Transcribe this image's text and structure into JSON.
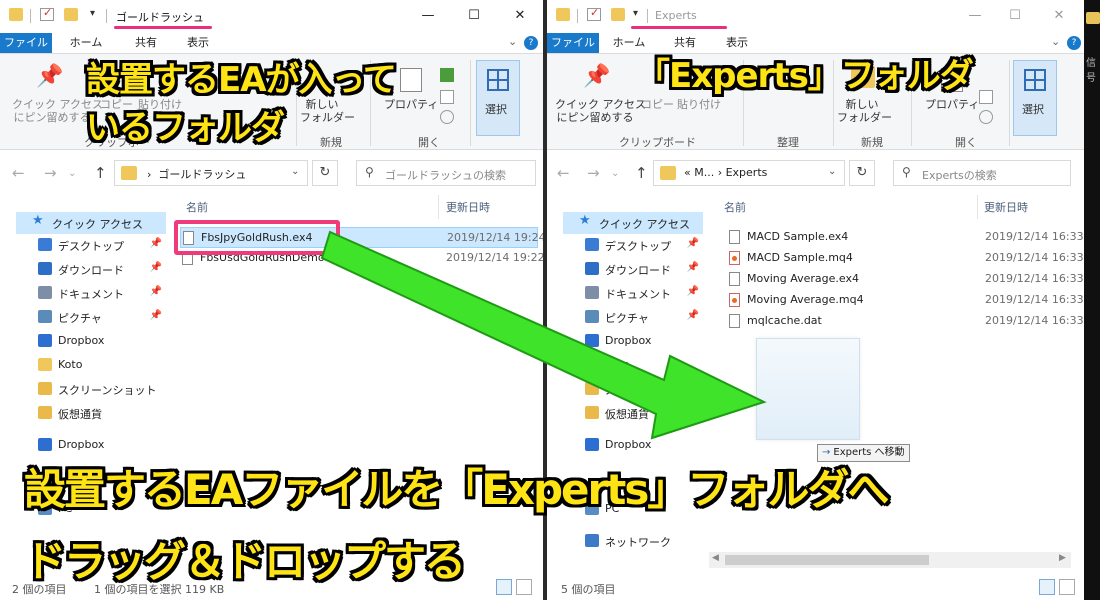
{
  "left_window": {
    "title": "ゴールドラッシュ",
    "tabs": {
      "file": "ファイル",
      "home": "ホーム",
      "share": "共有",
      "view": "表示"
    },
    "ribbon": {
      "quick_access": "クイック アクセス\nにピン留めする",
      "copy": "コピー",
      "paste": "貼り付け",
      "new_folder": "新しい\nフォルダー",
      "properties": "プロパティ",
      "select": "選択",
      "group_clipboard": "クリップボー",
      "group_new": "新規",
      "group_open": "開く"
    },
    "address_path": "ゴールドラッシュ",
    "search_placeholder": "ゴールドラッシュの検索",
    "col_name": "名前",
    "col_date": "更新日時",
    "nav": [
      {
        "label": "クイック アクセス"
      },
      {
        "label": "デスクトップ"
      },
      {
        "label": "ダウンロード"
      },
      {
        "label": "ドキュメント"
      },
      {
        "label": "ピクチャ"
      },
      {
        "label": "Dropbox"
      },
      {
        "label": "Koto"
      },
      {
        "label": "スクリーンショット"
      },
      {
        "label": "仮想通貨"
      },
      {
        "label": "Dropbox"
      },
      {
        "label": "PC"
      }
    ],
    "files": [
      {
        "name": "FbsJpyGoldRush.ex4",
        "date": "2019/12/14 19:24"
      },
      {
        "name": "FbsUsdGoldRushDemo.ex4",
        "date": "2019/12/14 19:22"
      }
    ],
    "status_items": "2 個の項目",
    "status_selected": "1 個の項目を選択  119 KB"
  },
  "right_window": {
    "title": "Experts",
    "tabs": {
      "file": "ファイル",
      "home": "ホーム",
      "share": "共有",
      "view": "表示"
    },
    "ribbon": {
      "quick_access": "クイック アクセス\nにピン留めする",
      "copy": "コピー",
      "paste": "貼り付け",
      "new_folder": "新しい\nフォルダー",
      "properties": "プロパティ",
      "select": "選択",
      "group_clipboard": "クリップボード",
      "group_organize": "整理",
      "group_new": "新規",
      "group_open": "開く"
    },
    "address_path": "«  M...  ›  Experts",
    "search_placeholder": "Expertsの検索",
    "col_name": "名前",
    "col_date": "更新日時",
    "nav": [
      {
        "label": "クイック アクセス"
      },
      {
        "label": "デスクトップ"
      },
      {
        "label": "ダウンロード"
      },
      {
        "label": "ドキュメント"
      },
      {
        "label": "ピクチャ"
      },
      {
        "label": "Dropbox"
      },
      {
        "label": "Koto"
      },
      {
        "label": "スクリーンショ"
      },
      {
        "label": "仮想通貨"
      },
      {
        "label": "Dropbox"
      },
      {
        "label": "PC"
      },
      {
        "label": "ネットワーク"
      }
    ],
    "files": [
      {
        "name": "MACD Sample.ex4",
        "date": "2019/12/14 16:33",
        "type": "ex4"
      },
      {
        "name": "MACD Sample.mq4",
        "date": "2019/12/14 16:33",
        "type": "mq4"
      },
      {
        "name": "Moving Average.ex4",
        "date": "2019/12/14 16:33",
        "type": "ex4"
      },
      {
        "name": "Moving Average.mq4",
        "date": "2019/12/14 16:33",
        "type": "mq4"
      },
      {
        "name": "mqlcache.dat",
        "date": "2019/12/14 16:33",
        "type": "dat"
      }
    ],
    "status_items": "5 個の項目",
    "drag_tooltip": "Experts へ移動"
  },
  "annotations": {
    "ea_folder_line1": "設置するEAが入って",
    "ea_folder_line2": "いるフォルダ",
    "experts_folder": "「Experts」フォルダ",
    "instruction_line1": "設置するEAファイルを「Experts」フォルダへ",
    "instruction_line2": "ドラッグ＆ドロップする"
  },
  "side_strip_text": "信号",
  "colors": {
    "annotation_fill": "#ffe415",
    "highlight_pink": "#ef3b7a",
    "arrow_green": "#3ee32a",
    "file_tab_blue": "#1979ca"
  }
}
